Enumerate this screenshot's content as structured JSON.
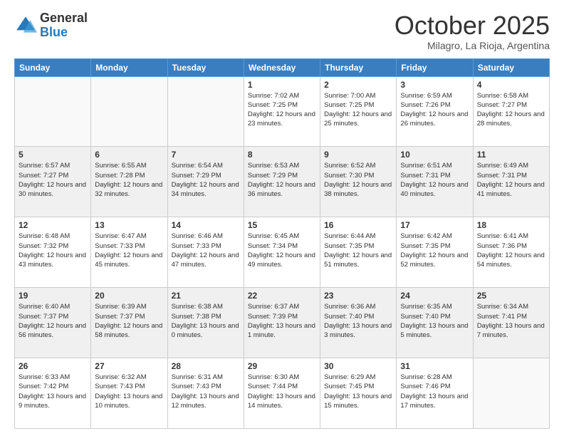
{
  "header": {
    "logo_general": "General",
    "logo_blue": "Blue",
    "month_title": "October 2025",
    "subtitle": "Milagro, La Rioja, Argentina"
  },
  "weekdays": [
    "Sunday",
    "Monday",
    "Tuesday",
    "Wednesday",
    "Thursday",
    "Friday",
    "Saturday"
  ],
  "weeks": [
    [
      {
        "day": "",
        "sunrise": "",
        "sunset": "",
        "daylight": "",
        "empty": true
      },
      {
        "day": "",
        "sunrise": "",
        "sunset": "",
        "daylight": "",
        "empty": true
      },
      {
        "day": "",
        "sunrise": "",
        "sunset": "",
        "daylight": "",
        "empty": true
      },
      {
        "day": "1",
        "sunrise": "Sunrise: 7:02 AM",
        "sunset": "Sunset: 7:25 PM",
        "daylight": "Daylight: 12 hours and 23 minutes."
      },
      {
        "day": "2",
        "sunrise": "Sunrise: 7:00 AM",
        "sunset": "Sunset: 7:25 PM",
        "daylight": "Daylight: 12 hours and 25 minutes."
      },
      {
        "day": "3",
        "sunrise": "Sunrise: 6:59 AM",
        "sunset": "Sunset: 7:26 PM",
        "daylight": "Daylight: 12 hours and 26 minutes."
      },
      {
        "day": "4",
        "sunrise": "Sunrise: 6:58 AM",
        "sunset": "Sunset: 7:27 PM",
        "daylight": "Daylight: 12 hours and 28 minutes."
      }
    ],
    [
      {
        "day": "5",
        "sunrise": "Sunrise: 6:57 AM",
        "sunset": "Sunset: 7:27 PM",
        "daylight": "Daylight: 12 hours and 30 minutes."
      },
      {
        "day": "6",
        "sunrise": "Sunrise: 6:55 AM",
        "sunset": "Sunset: 7:28 PM",
        "daylight": "Daylight: 12 hours and 32 minutes."
      },
      {
        "day": "7",
        "sunrise": "Sunrise: 6:54 AM",
        "sunset": "Sunset: 7:29 PM",
        "daylight": "Daylight: 12 hours and 34 minutes."
      },
      {
        "day": "8",
        "sunrise": "Sunrise: 6:53 AM",
        "sunset": "Sunset: 7:29 PM",
        "daylight": "Daylight: 12 hours and 36 minutes."
      },
      {
        "day": "9",
        "sunrise": "Sunrise: 6:52 AM",
        "sunset": "Sunset: 7:30 PM",
        "daylight": "Daylight: 12 hours and 38 minutes."
      },
      {
        "day": "10",
        "sunrise": "Sunrise: 6:51 AM",
        "sunset": "Sunset: 7:31 PM",
        "daylight": "Daylight: 12 hours and 40 minutes."
      },
      {
        "day": "11",
        "sunrise": "Sunrise: 6:49 AM",
        "sunset": "Sunset: 7:31 PM",
        "daylight": "Daylight: 12 hours and 41 minutes."
      }
    ],
    [
      {
        "day": "12",
        "sunrise": "Sunrise: 6:48 AM",
        "sunset": "Sunset: 7:32 PM",
        "daylight": "Daylight: 12 hours and 43 minutes."
      },
      {
        "day": "13",
        "sunrise": "Sunrise: 6:47 AM",
        "sunset": "Sunset: 7:33 PM",
        "daylight": "Daylight: 12 hours and 45 minutes."
      },
      {
        "day": "14",
        "sunrise": "Sunrise: 6:46 AM",
        "sunset": "Sunset: 7:33 PM",
        "daylight": "Daylight: 12 hours and 47 minutes."
      },
      {
        "day": "15",
        "sunrise": "Sunrise: 6:45 AM",
        "sunset": "Sunset: 7:34 PM",
        "daylight": "Daylight: 12 hours and 49 minutes."
      },
      {
        "day": "16",
        "sunrise": "Sunrise: 6:44 AM",
        "sunset": "Sunset: 7:35 PM",
        "daylight": "Daylight: 12 hours and 51 minutes."
      },
      {
        "day": "17",
        "sunrise": "Sunrise: 6:42 AM",
        "sunset": "Sunset: 7:35 PM",
        "daylight": "Daylight: 12 hours and 52 minutes."
      },
      {
        "day": "18",
        "sunrise": "Sunrise: 6:41 AM",
        "sunset": "Sunset: 7:36 PM",
        "daylight": "Daylight: 12 hours and 54 minutes."
      }
    ],
    [
      {
        "day": "19",
        "sunrise": "Sunrise: 6:40 AM",
        "sunset": "Sunset: 7:37 PM",
        "daylight": "Daylight: 12 hours and 56 minutes."
      },
      {
        "day": "20",
        "sunrise": "Sunrise: 6:39 AM",
        "sunset": "Sunset: 7:37 PM",
        "daylight": "Daylight: 12 hours and 58 minutes."
      },
      {
        "day": "21",
        "sunrise": "Sunrise: 6:38 AM",
        "sunset": "Sunset: 7:38 PM",
        "daylight": "Daylight: 13 hours and 0 minutes."
      },
      {
        "day": "22",
        "sunrise": "Sunrise: 6:37 AM",
        "sunset": "Sunset: 7:39 PM",
        "daylight": "Daylight: 13 hours and 1 minute."
      },
      {
        "day": "23",
        "sunrise": "Sunrise: 6:36 AM",
        "sunset": "Sunset: 7:40 PM",
        "daylight": "Daylight: 13 hours and 3 minutes."
      },
      {
        "day": "24",
        "sunrise": "Sunrise: 6:35 AM",
        "sunset": "Sunset: 7:40 PM",
        "daylight": "Daylight: 13 hours and 5 minutes."
      },
      {
        "day": "25",
        "sunrise": "Sunrise: 6:34 AM",
        "sunset": "Sunset: 7:41 PM",
        "daylight": "Daylight: 13 hours and 7 minutes."
      }
    ],
    [
      {
        "day": "26",
        "sunrise": "Sunrise: 6:33 AM",
        "sunset": "Sunset: 7:42 PM",
        "daylight": "Daylight: 13 hours and 9 minutes."
      },
      {
        "day": "27",
        "sunrise": "Sunrise: 6:32 AM",
        "sunset": "Sunset: 7:43 PM",
        "daylight": "Daylight: 13 hours and 10 minutes."
      },
      {
        "day": "28",
        "sunrise": "Sunrise: 6:31 AM",
        "sunset": "Sunset: 7:43 PM",
        "daylight": "Daylight: 13 hours and 12 minutes."
      },
      {
        "day": "29",
        "sunrise": "Sunrise: 6:30 AM",
        "sunset": "Sunset: 7:44 PM",
        "daylight": "Daylight: 13 hours and 14 minutes."
      },
      {
        "day": "30",
        "sunrise": "Sunrise: 6:29 AM",
        "sunset": "Sunset: 7:45 PM",
        "daylight": "Daylight: 13 hours and 15 minutes."
      },
      {
        "day": "31",
        "sunrise": "Sunrise: 6:28 AM",
        "sunset": "Sunset: 7:46 PM",
        "daylight": "Daylight: 13 hours and 17 minutes."
      },
      {
        "day": "",
        "sunrise": "",
        "sunset": "",
        "daylight": "",
        "empty": true
      }
    ]
  ]
}
